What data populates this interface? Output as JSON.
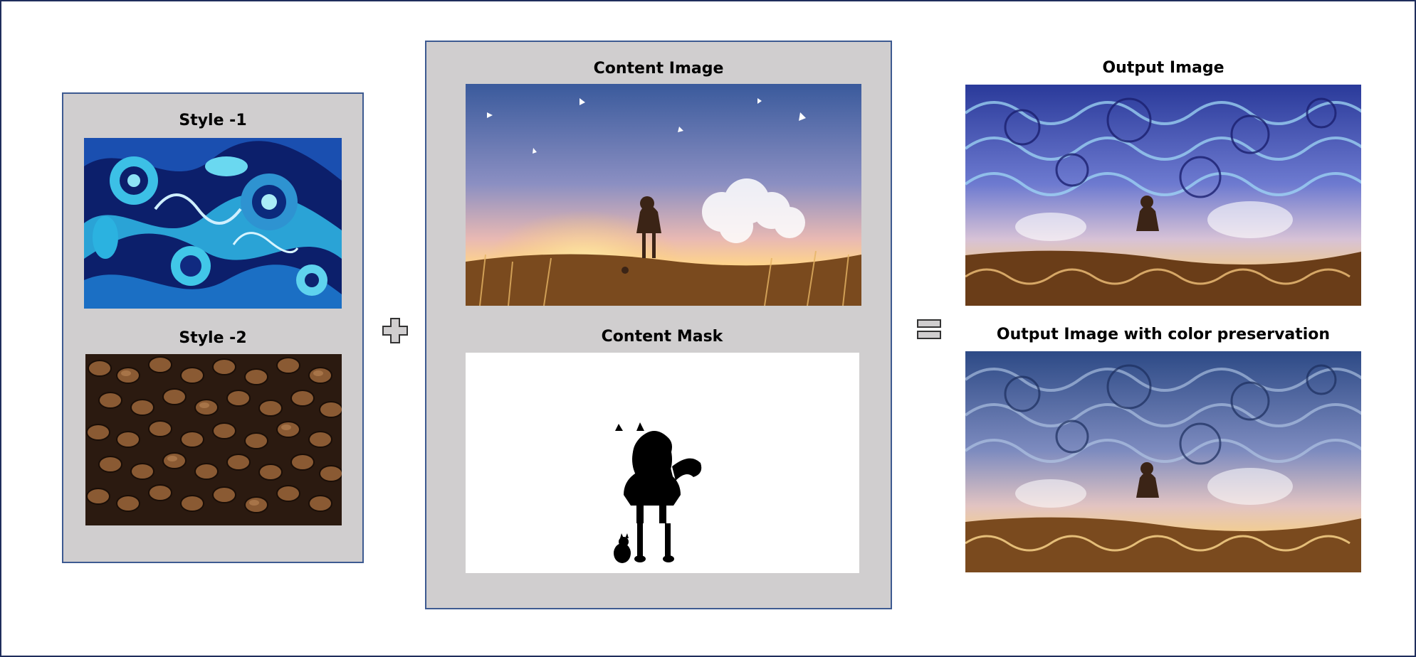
{
  "style_panel": {
    "style1_label": "Style -1",
    "style2_label": "Style -2"
  },
  "content_panel": {
    "content_label": "Content Image",
    "mask_label": "Content Mask"
  },
  "output": {
    "output_label": "Output Image",
    "output_color_label": "Output Image with color preservation"
  },
  "operators": {
    "plus": "plus-icon",
    "equals": "equals-icon"
  },
  "colors": {
    "panel_fill": "#d0cecf",
    "panel_border": "#3d5a91",
    "frame_border": "#1f2d5c"
  }
}
